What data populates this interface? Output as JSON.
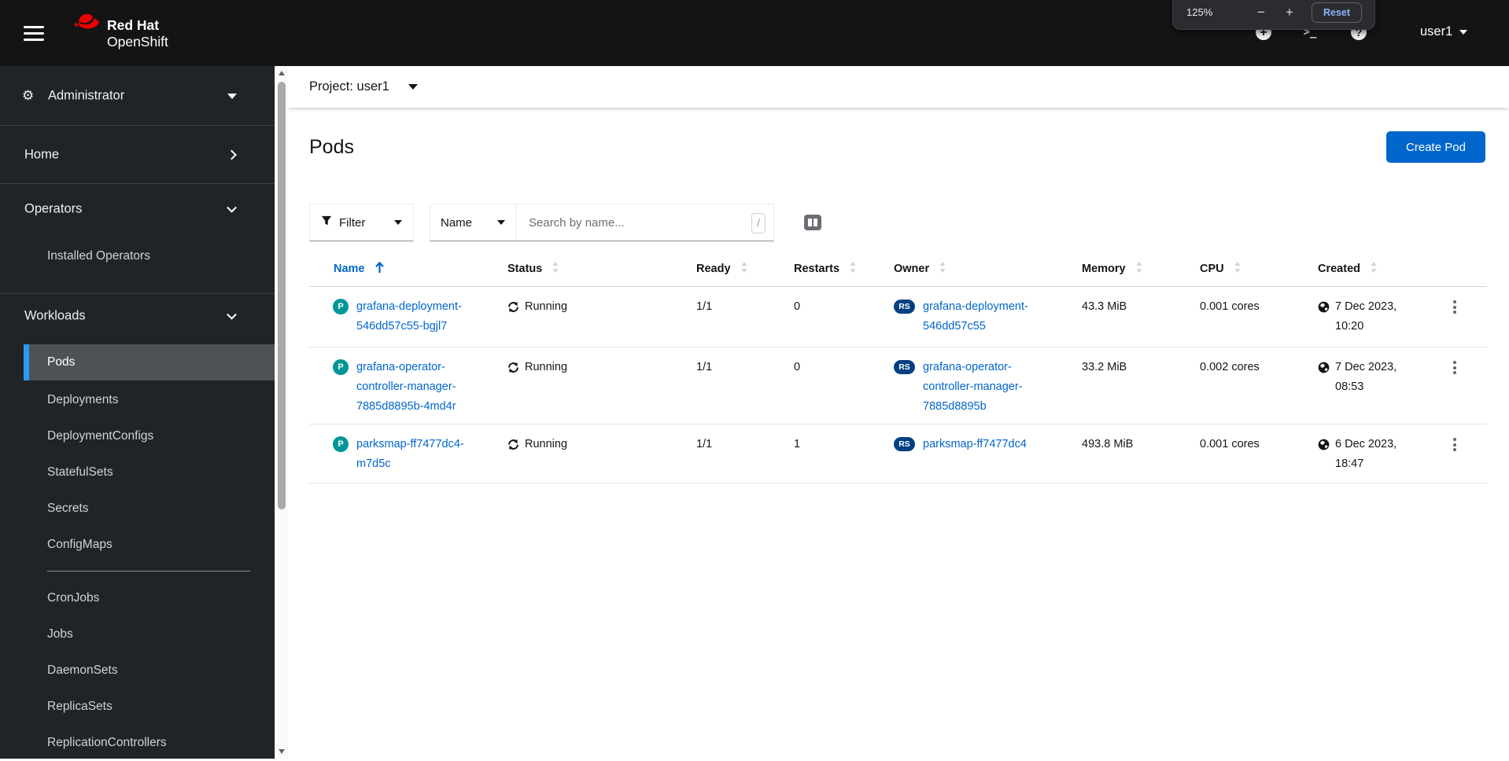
{
  "masthead": {
    "brand_line1": "Red Hat",
    "brand_line2": "OpenShift",
    "username": "user1",
    "zoom_overlay": {
      "level": "125%",
      "minus": "−",
      "plus": "+",
      "reset": "Reset"
    }
  },
  "sidebar": {
    "perspective": "Administrator",
    "home": "Home",
    "operators": "Operators",
    "installed_operators": "Installed Operators",
    "workloads": "Workloads",
    "items_group1": [
      "Pods",
      "Deployments",
      "DeploymentConfigs",
      "StatefulSets",
      "Secrets",
      "ConfigMaps"
    ],
    "items_group2": [
      "CronJobs",
      "Jobs",
      "DaemonSets",
      "ReplicaSets",
      "ReplicationControllers"
    ],
    "selected_item": "Pods"
  },
  "project_bar": {
    "label": "Project: user1"
  },
  "page_header": {
    "title": "Pods",
    "create_button": "Create Pod"
  },
  "toolbar": {
    "filter": "Filter",
    "name_filter": "Name",
    "search_placeholder": "Search by name...",
    "shortcut": "/"
  },
  "table": {
    "columns": [
      "Name",
      "Status",
      "Ready",
      "Restarts",
      "Owner",
      "Memory",
      "CPU",
      "Created"
    ],
    "sort_column": "Name",
    "sort_direction": "ascending",
    "rows": [
      {
        "badge": "P",
        "owner_badge": "RS",
        "name_lines": [
          "grafana-deployment-",
          "546dd57c55-bgjl7"
        ],
        "status": "Running",
        "ready": "1/1",
        "restarts": "0",
        "owner_lines": [
          "grafana-deployment-",
          "546dd57c55"
        ],
        "memory": "43.3 MiB",
        "cpu": "0.001 cores",
        "created_lines": [
          "7 Dec 2023,",
          "10:20"
        ]
      },
      {
        "badge": "P",
        "owner_badge": "RS",
        "name_lines": [
          "grafana-operator-",
          "controller-manager-",
          "7885d8895b-4md4r"
        ],
        "status": "Running",
        "ready": "1/1",
        "restarts": "0",
        "owner_lines": [
          "grafana-operator-",
          "controller-manager-",
          "7885d8895b"
        ],
        "memory": "33.2 MiB",
        "cpu": "0.002 cores",
        "created_lines": [
          "7 Dec 2023,",
          "08:53"
        ]
      },
      {
        "badge": "P",
        "owner_badge": "RS",
        "name_lines": [
          "parksmap-ff7477dc4-",
          "m7d5c"
        ],
        "status": "Running",
        "ready": "1/1",
        "restarts": "1",
        "owner_lines": [
          "parksmap-ff7477dc4"
        ],
        "memory": "493.8 MiB",
        "cpu": "0.001 cores",
        "created_lines": [
          "6 Dec 2023,",
          "18:47"
        ]
      }
    ]
  },
  "colors": {
    "link": "#0066cc",
    "primary_button": "#0066cc",
    "pod_badge": "#009596",
    "replicaset_badge": "#004080",
    "masthead_bg": "#141414",
    "sidebar_bg": "#212427",
    "selected_nav_bg": "#4f5255",
    "selected_nav_accent": "#2b9af3"
  }
}
